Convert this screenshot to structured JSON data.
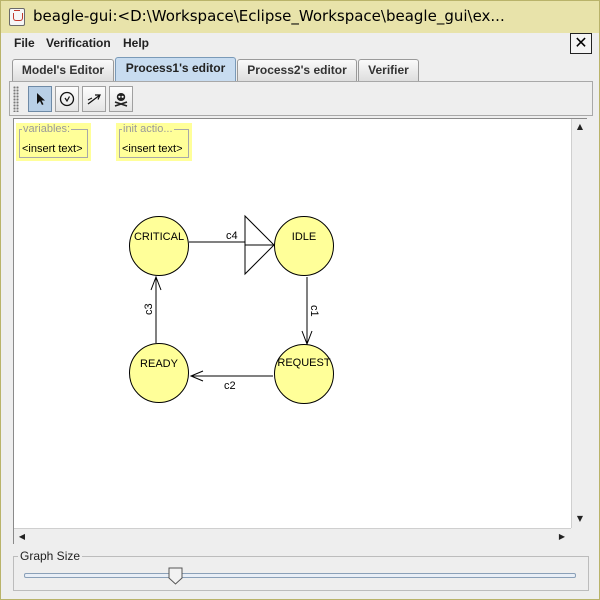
{
  "window": {
    "title": "beagle-gui:<D:\\Workspace\\Eclipse_Workspace\\beagle_gui\\ex..."
  },
  "menu": [
    {
      "label": "File"
    },
    {
      "label": "Verification"
    },
    {
      "label": "Help"
    }
  ],
  "tabs": [
    {
      "label": "Model's Editor",
      "active": false
    },
    {
      "label": "Process1's editor",
      "active": true
    },
    {
      "label": "Process2's editor",
      "active": false
    },
    {
      "label": "Verifier",
      "active": false
    }
  ],
  "toolbar": {
    "tools": [
      {
        "icon": "pointer-icon",
        "selected": true
      },
      {
        "icon": "state-icon",
        "selected": false
      },
      {
        "icon": "transition-icon",
        "selected": false
      },
      {
        "icon": "skull-icon",
        "selected": false
      }
    ]
  },
  "notes": [
    {
      "title": "variables:",
      "text": "<insert text>"
    },
    {
      "title": "init actio...",
      "text": "<insert text>"
    }
  ],
  "states": [
    {
      "id": "critical",
      "label": "CRITICAL"
    },
    {
      "id": "idle",
      "label": "IDLE"
    },
    {
      "id": "request",
      "label": "REQUEST"
    },
    {
      "id": "ready",
      "label": "READY"
    }
  ],
  "transitions": [
    {
      "label": "c4",
      "from": "CRITICAL",
      "to": "IDLE"
    },
    {
      "label": "c1",
      "from": "IDLE",
      "to": "REQUEST"
    },
    {
      "label": "c2",
      "from": "REQUEST",
      "to": "READY"
    },
    {
      "label": "c3",
      "from": "READY",
      "to": "CRITICAL"
    }
  ],
  "graph_size": {
    "label": "Graph Size",
    "slider_value": 0.28
  },
  "colors": {
    "state_fill": "#ffff99",
    "note_fill": "#ffff99",
    "active_tab": "#c8dcf0"
  }
}
